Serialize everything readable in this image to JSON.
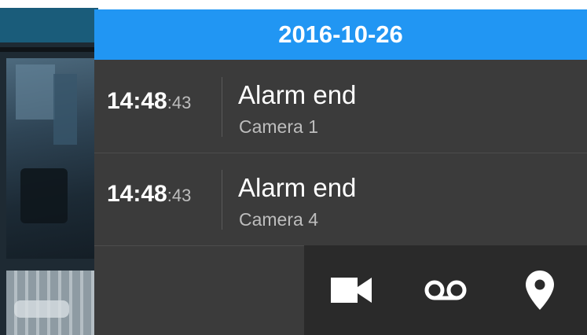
{
  "date_header": "2016-10-26",
  "events": [
    {
      "time_hm": "14:48",
      "time_sec": ":43",
      "title": "Alarm end",
      "camera": "Camera 1"
    },
    {
      "time_hm": "14:48",
      "time_sec": ":43",
      "title": "Alarm end",
      "camera": "Camera 4"
    }
  ],
  "actions": [
    {
      "icon": "video-camera-icon"
    },
    {
      "icon": "voicemail-recording-icon"
    },
    {
      "icon": "location-pin-icon"
    }
  ],
  "colors": {
    "header": "#2196f3",
    "panel": "#3b3b3b",
    "action_bar": "#2a2a2a",
    "text_primary": "#ffffff",
    "text_secondary": "#bdbdbd"
  }
}
